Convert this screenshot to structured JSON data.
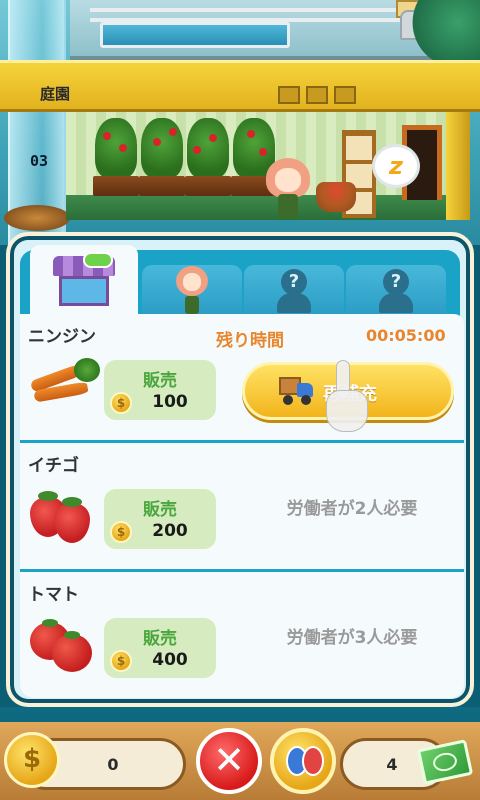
{
  "scene": {
    "floor_title": "庭園",
    "floor_counter": "03",
    "sleep_icon": "zzz-icon"
  },
  "tabs": [
    {
      "name": "shop",
      "icon": "shop-icon",
      "active": true
    },
    {
      "name": "worker",
      "icon": "worker-icon",
      "active": false
    },
    {
      "name": "locked-1",
      "icon": "locked-silhouette-icon",
      "label": "?",
      "active": false
    },
    {
      "name": "locked-2",
      "icon": "locked-silhouette-icon",
      "label": "?",
      "active": false
    }
  ],
  "items": [
    {
      "name": "ニンジン",
      "icon": "carrot-icon",
      "sell_label": "販売",
      "price": "100",
      "timer_label": "残り時間",
      "timer_value": "00:05:00",
      "restock_label": "再補充"
    },
    {
      "name": "イチゴ",
      "icon": "strawberry-icon",
      "sell_label": "販売",
      "price": "200",
      "requirement": "労働者が2人必要"
    },
    {
      "name": "トマト",
      "icon": "tomato-icon",
      "sell_label": "販売",
      "price": "400",
      "requirement": "労働者が3人必要"
    }
  ],
  "bottom_bar": {
    "coins": "0",
    "cash": "4",
    "close_icon": "close-icon",
    "social_icon": "friends-icon",
    "cash_icon": "cash-icon"
  },
  "colors": {
    "accent_orange": "#e8862e",
    "sell_green": "#4ba63e",
    "panel_blue": "#1aa3c7",
    "restock_yellow": "#f2b41c"
  }
}
